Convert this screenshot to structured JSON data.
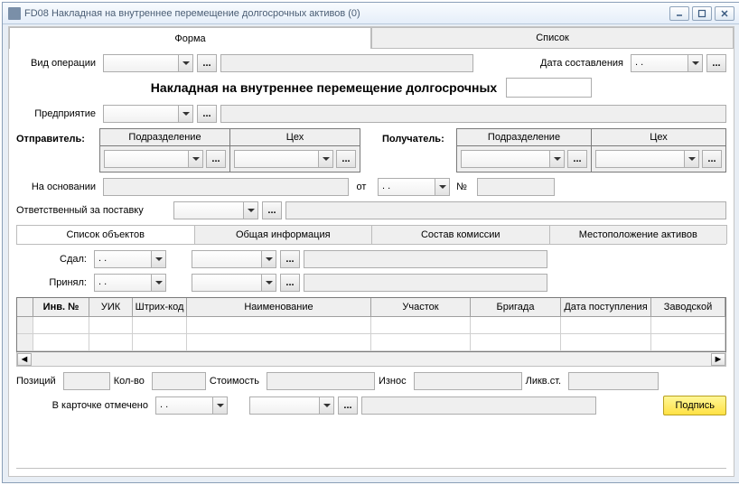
{
  "window": {
    "title": "FD08 Накладная на внутреннее перемещение долгосрочных активов (0)"
  },
  "tabs": {
    "form": "Форма",
    "list": "Список"
  },
  "labels": {
    "opType": "Вид операции",
    "date": "Дата составления",
    "docTitle": "Накладная на внутреннее перемещение долгосрочных",
    "enterprise": "Предприятие",
    "sender": "Отправитель:",
    "receiver": "Получатель:",
    "subdivision": "Подразделение",
    "workshop": "Цех",
    "basis": "На основании",
    "from": "от",
    "no": "№",
    "responsible": "Ответственный за поставку",
    "gave": "Сдал:",
    "received": "Принял:",
    "positions": "Позиций",
    "qty": "Кол-во",
    "cost": "Стоимость",
    "wear": "Износ",
    "liqcost": "Ликв.ст.",
    "markedInCard": "В карточке отмечено",
    "sign": "Подпись",
    "dots": "...",
    "dotsDate": " .  ."
  },
  "subtabs": {
    "objList": "Список объектов",
    "general": "Общая информация",
    "commission": "Состав комиссии",
    "location": "Местоположение активов"
  },
  "gridCols": {
    "inv": "Инв. №",
    "uik": "УИК",
    "barcode": "Штрих-код",
    "name": "Наименование",
    "area": "Участок",
    "brigade": "Бригада",
    "recvDate": "Дата поступления",
    "factory": "Заводской"
  }
}
